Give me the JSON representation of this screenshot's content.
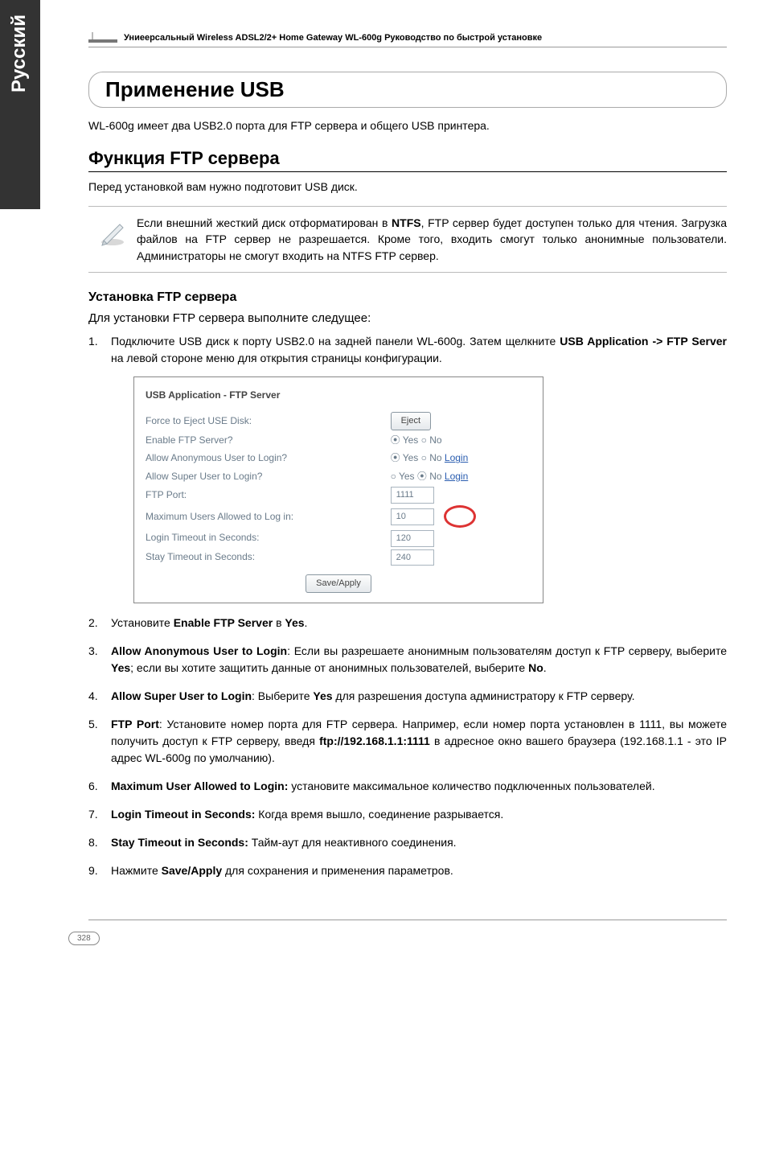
{
  "sidebar": {
    "lang": "Русский"
  },
  "header": {
    "line": "Униеерсальный Wireless ADSL2/2+ Home Gateway  WL-600g Руководство по быстрой установке"
  },
  "title": "Применение USB",
  "intro": "WL-600g имеет два USB2.0 порта для FTP сервера и общего USB принтера.",
  "section_ftp": "Функция FTP сервера",
  "prep": "Перед установкой вам нужно подготовит USB диск.",
  "note": {
    "text_parts": [
      "Если внешний жесткий диск отформатирован в ",
      "NTFS",
      ", FTP сервер будет доступен только для чтения. Загрузка файлов на FTP сервер не разрешается. Кроме того, входить смогут только анонимные пользователи. Администраторы  не смогут входить на NTFS FTP сервер."
    ]
  },
  "sub_install": "Установка FTP сервера",
  "install_intro": "Для установки FTP сервера выполните следущее:",
  "steps": [
    {
      "pre": "Подключите USB диск к порту USB2.0 на задней панели WL-600g. Затем щелкните ",
      "b": "USB Application -> FTP Server",
      "post": " на левой стороне меню для открытия страницы конфигурации."
    },
    {
      "pre": "Установите ",
      "b": "Enable FTP Server",
      "mid": " в ",
      "b2": "Yes",
      "post": "."
    },
    {
      "b": "Allow Anonymous User to Login",
      "pre2": ": Если вы разрешаете анонимным пользователям доступ к FTP серверу, выберите ",
      "b2": "Yes",
      "mid2": "; если вы хотите защитить данные от анонимных пользователей, выберите ",
      "b3": "No",
      "post": "."
    },
    {
      "b": "Allow Super User to Login",
      "pre2": ": Выберите ",
      "b2": "Yes",
      "post": " для разрешения доступа администратору к FTP серверу."
    },
    {
      "b": "FTP Port",
      "pre2": ": Установите номер порта для FTP сервера. Например, если номер порта установлен в 1111, вы можете получить доступ к FTP серверу, введя ",
      "b2": "ftp://192.168.1.1:1111",
      "post": " в адресное окно вашего браузера (192.168.1.1 - это IP адрес WL-600g по умолчанию)."
    },
    {
      "b": "Maximum User Allowed to Login:",
      "post": " установите максимальное количество подключенных пользователей."
    },
    {
      "b": "Login Timeout in Seconds:",
      "post": " Когда время вышло, соединение разрывается."
    },
    {
      "b": "Stay Timeout in Seconds:",
      "post": " Тайм-аут для неактивного соединения."
    },
    {
      "pre": "Нажмите ",
      "b": "Save/Apply",
      "post": " для сохранения и применения параметров."
    }
  ],
  "screenshot": {
    "title": "USB Application - FTP Server",
    "rows": {
      "eject_label": "Force to Eject USE Disk:",
      "eject_btn": "Eject",
      "enable_label": "Enable FTP Server?",
      "enable_val": "⦿ Yes  ○ No",
      "anon_label": "Allow Anonymous User to Login?",
      "anon_val": "⦿ Yes  ○ No ",
      "anon_login": "Login",
      "super_label": "Allow Super User to Login?",
      "super_val": "○ Yes  ⦿ No ",
      "super_login": "Login",
      "port_label": "FTP Port:",
      "port_val": "1111",
      "max_label": "Maximum Users Allowed to Log in:",
      "max_val": "10",
      "ltimeout_label": "Login Timeout in Seconds:",
      "ltimeout_val": "120",
      "stimeout_label": "Stay Timeout in Seconds:",
      "stimeout_val": "240",
      "apply_btn": "Save/Apply"
    }
  },
  "chart_data": {
    "type": "table",
    "title": "USB Application - FTP Server",
    "rows": [
      {
        "label": "Force to Eject USE Disk:",
        "value": "Eject (button)"
      },
      {
        "label": "Enable FTP Server?",
        "value": "Yes",
        "options": [
          "Yes",
          "No"
        ]
      },
      {
        "label": "Allow Anonymous User to Login?",
        "value": "Yes",
        "options": [
          "Yes",
          "No"
        ],
        "link": "Login"
      },
      {
        "label": "Allow Super User to Login?",
        "value": "No",
        "options": [
          "Yes",
          "No"
        ],
        "link": "Login"
      },
      {
        "label": "FTP Port:",
        "value": 1111
      },
      {
        "label": "Maximum Users Allowed to Log in:",
        "value": 10
      },
      {
        "label": "Login Timeout in Seconds:",
        "value": 120
      },
      {
        "label": "Stay Timeout in Seconds:",
        "value": 240
      }
    ],
    "action_button": "Save/Apply"
  },
  "page_number": "328"
}
